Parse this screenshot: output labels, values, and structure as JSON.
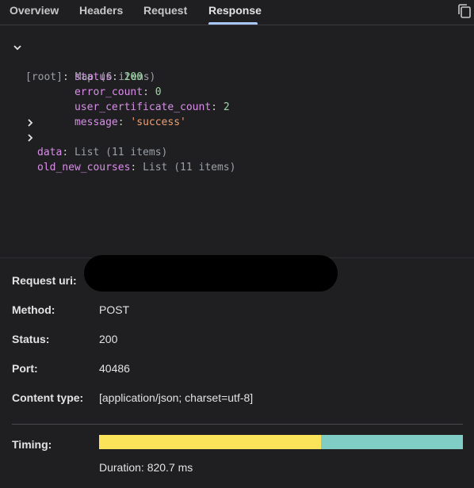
{
  "tabs": [
    {
      "label": "Overview"
    },
    {
      "label": "Headers"
    },
    {
      "label": "Request"
    },
    {
      "label": "Response"
    }
  ],
  "active_tab": "Response",
  "tree": {
    "root_key": "[root]",
    "root_type": "Map (6 items)",
    "fields": [
      {
        "key": "status",
        "value": "200",
        "kind": "number"
      },
      {
        "key": "error_count",
        "value": "0",
        "kind": "number"
      },
      {
        "key": "user_certificate_count",
        "value": "2",
        "kind": "number"
      },
      {
        "key": "message",
        "value": "'success'",
        "kind": "string"
      }
    ],
    "collapsed": [
      {
        "key": "data",
        "type": "List (11 items)"
      },
      {
        "key": "old_new_courses",
        "type": "List (11 items)"
      }
    ]
  },
  "details": {
    "request_uri_label": "Request uri:",
    "method_label": "Method:",
    "method_value": "POST",
    "status_label": "Status:",
    "status_value": "200",
    "port_label": "Port:",
    "port_value": "40486",
    "content_type_label": "Content type:",
    "content_type_value": "[application/json; charset=utf-8]",
    "timing_label": "Timing:",
    "duration_text": "Duration: 820.7 ms",
    "timing_wait_fraction": 0.61
  },
  "colors": {
    "timing_wait": "#fbe45a",
    "timing_receive": "#7fcdc4",
    "active_tab_underline": "#a8c7fa"
  },
  "icons": {
    "copy": "copy-icon",
    "expanded": "chevron-down-icon",
    "collapsed": "chevron-right-icon"
  }
}
